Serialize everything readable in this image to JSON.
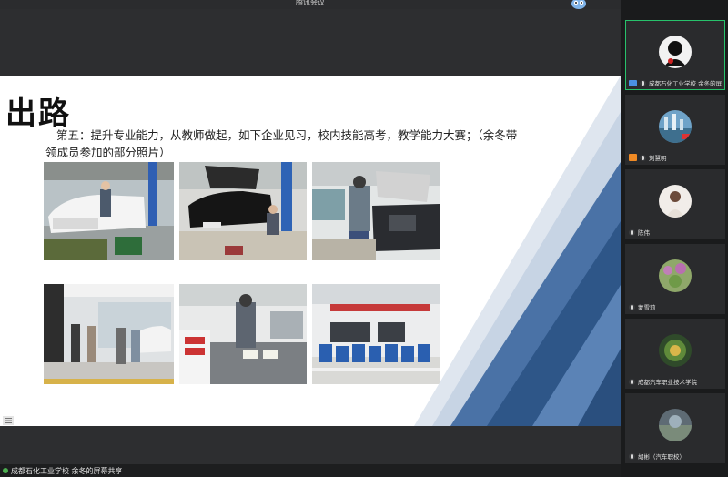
{
  "window": {
    "title": "腾讯会议"
  },
  "slide": {
    "title": "出路",
    "text_line1": "第五：提升专业能力，从教师做起，如下企业见习，校内技能高考，教学能力大赛；（余冬带",
    "text_line2": "领成员参加的部分照片）"
  },
  "status": {
    "sharing_label": "成都石化工业学校 余冬的屏幕共享"
  },
  "participants": [
    {
      "name": "成都石化工业学校 余冬的屏幕共享",
      "active": true
    },
    {
      "name": "刘慧明"
    },
    {
      "name": "陈伟"
    },
    {
      "name": "蒙雪莉"
    },
    {
      "name": "成都汽车职业技术学院"
    },
    {
      "name": "胡彬（汽车职校）"
    }
  ],
  "colors": {
    "active_border": "#27c26b",
    "deco_blue": "#4a72a6",
    "deco_dark": "#2e5688"
  }
}
